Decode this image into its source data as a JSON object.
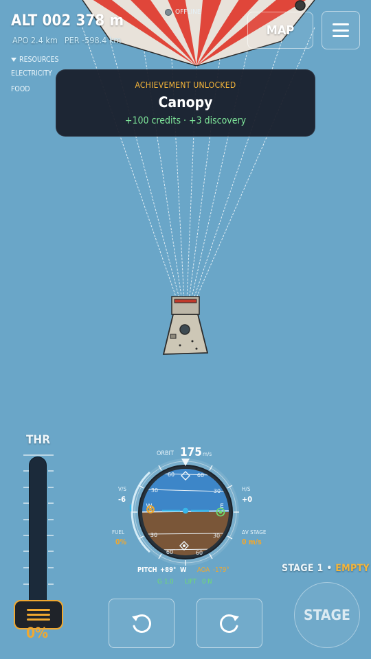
{
  "header": {
    "altitude": "ALT 002 378 m",
    "apoapsis": "APO 2.4 km",
    "periapsis": "PER -598.4 km",
    "connection_status": "OFFLINE",
    "map_label": "MAP"
  },
  "resources": {
    "title": "RESOURCES",
    "items": [
      {
        "label": "ELECTRICITY"
      },
      {
        "label": "FOOD"
      }
    ]
  },
  "achievement": {
    "heading": "ACHIEVEMENT UNLOCKED",
    "name": "Canopy",
    "reward": "+100 credits · +3 discovery"
  },
  "throttle": {
    "label": "THR",
    "percent": "0%",
    "level": 0
  },
  "navball": {
    "mode": "ORBIT",
    "speed": "175",
    "speed_unit": "m/s",
    "vs_label": "V/S",
    "vs_value": "-6",
    "hs_label": "H/S",
    "hs_value": "+0",
    "fuel_label": "FUEL",
    "fuel_value": "0%",
    "dv_label": "ΔV STAGE",
    "dv_value": "0 m/s",
    "pitch_label": "PITCH",
    "pitch_value": "+89°",
    "heading": "W",
    "aoa_label": "AOA",
    "aoa_value": "-179°",
    "g_label": "G",
    "g_value": "1.0",
    "lift_label": "LIFT",
    "lift_value": "0 N",
    "tick_labels": [
      "60",
      "60",
      "30",
      "30",
      "30",
      "30",
      "60",
      "60"
    ],
    "compass_w": "W",
    "compass_e": "E"
  },
  "stage": {
    "label": "STAGE 1",
    "separator": "•",
    "state": "EMPTY",
    "button_label": "STAGE"
  },
  "controls": {
    "rotate_left": "rotate-ccw-icon",
    "rotate_right": "rotate-cw-icon"
  },
  "colors": {
    "sky": "#6aa6c8",
    "accent_orange": "#f0a830",
    "achievement_green": "#7fe79a",
    "chute_red": "#e0463a"
  }
}
